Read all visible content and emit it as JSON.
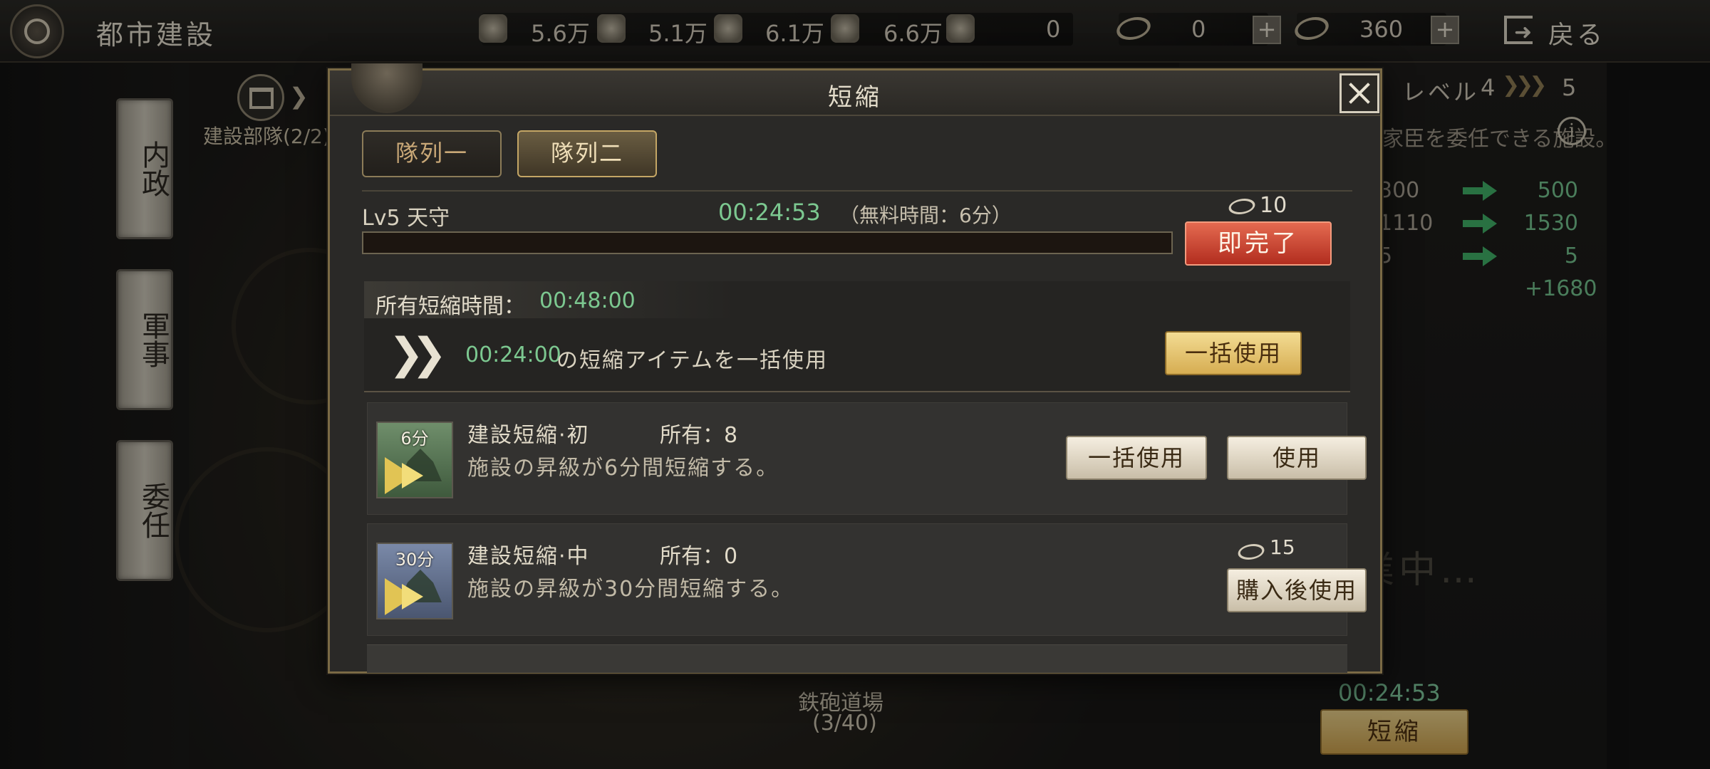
{
  "top_bar": {
    "title": "都市建設",
    "resources": [
      {
        "icon": "coin-resource-icon",
        "value": "5.6万"
      },
      {
        "icon": "wood-resource-icon",
        "value": "5.1万"
      },
      {
        "icon": "stone-resource-icon",
        "value": "6.1万"
      },
      {
        "icon": "iron-resource-icon",
        "value": "6.6万"
      },
      {
        "icon": "rice-resource-icon",
        "value": "0"
      }
    ],
    "currency_1": "0",
    "currency_2": "360",
    "back_label": "戻る"
  },
  "side_tabs": [
    "内政",
    "軍事",
    "委任"
  ],
  "background": {
    "team_label": "建設部隊(2/2)",
    "building_name": "鉄砲道場",
    "building_count": "(3/40)",
    "timer": "00:24:53",
    "shorten_label": "短縮",
    "in_progress": "業中…"
  },
  "right_panel": {
    "level_label": "レベル",
    "level_from": "4",
    "level_to": "5",
    "description": "家臣を委任できる施設。",
    "stats": [
      {
        "from": "300",
        "to": "500"
      },
      {
        "from": "1110",
        "to": "1530"
      },
      {
        "from": "5",
        "to": "5"
      }
    ],
    "bonus": "+1680"
  },
  "modal": {
    "title": "短縮",
    "tabs": [
      "隊列一",
      "隊列二"
    ],
    "selected_tab": "隊列二",
    "building_label": "Lv5 天守",
    "building_timer": "00:24:53",
    "free_time": "（無料時間：6分）",
    "progress": 0,
    "instant_cost": "10",
    "instant_label": "即完了",
    "owned_label": "所有短縮時間：",
    "owned_time": "00:48:00",
    "bulk_time": "00:24:00",
    "bulk_text": "の短縮アイテムを一括使用",
    "bulk_button": "一括使用",
    "items": [
      {
        "thumb_label": "6分",
        "name": "建設短縮·初",
        "owned": "所有：8",
        "desc": "施設の昇級が6分間短縮する。",
        "bulk_button": "一括使用",
        "use_button": "使用"
      },
      {
        "thumb_label": "30分",
        "name": "建設短縮·中",
        "owned": "所有：0",
        "desc": "施設の昇級が30分間短縮する。",
        "cost": "15",
        "buy_button": "購入後使用"
      }
    ]
  },
  "colors": {
    "timer_green": "#7cc890",
    "instant_red": "#c23a28",
    "gold_button": "#e6c46e",
    "modal_border": "#7a6a45"
  }
}
